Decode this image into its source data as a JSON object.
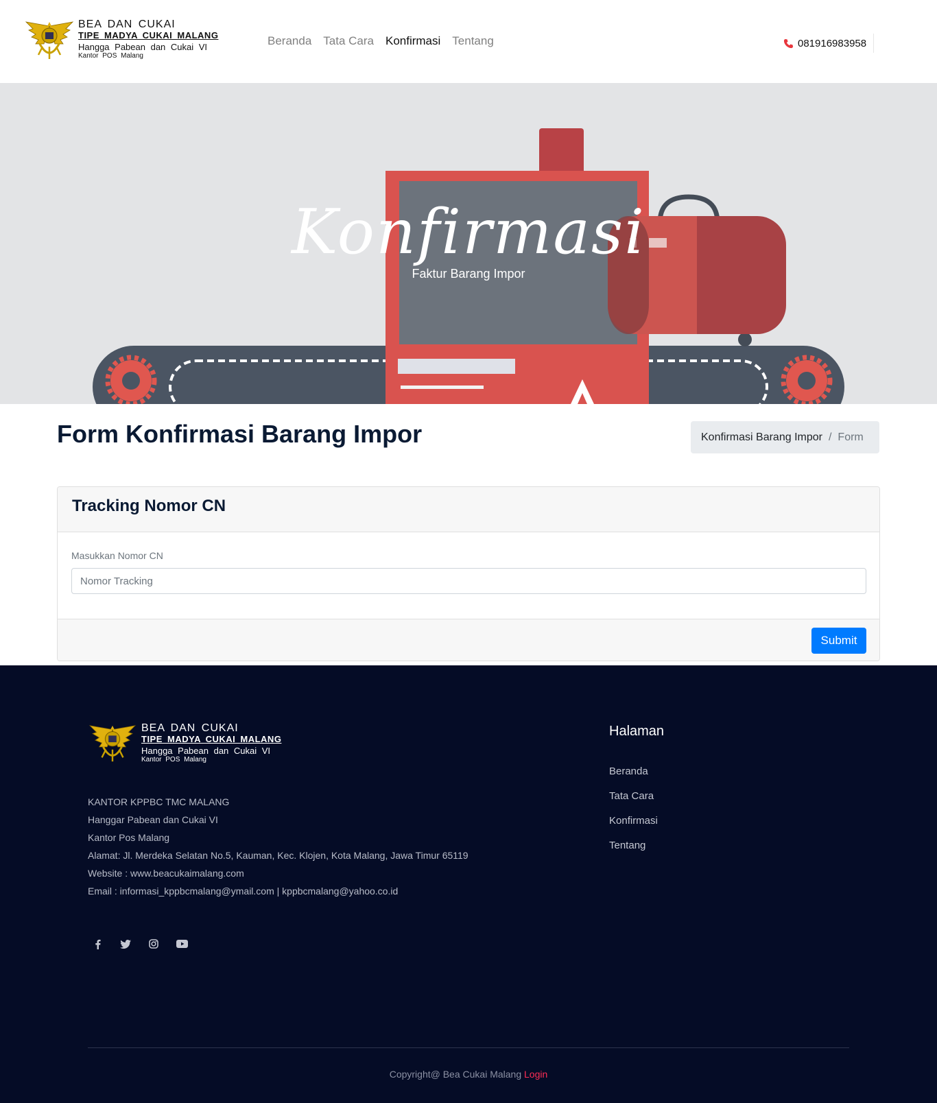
{
  "brand": {
    "line1": "BEA  DAN  CUKAI",
    "line2": "TIPE  MADYA  CUKAI  MALANG",
    "line3": "Hangga  Pabean  dan  Cukai  VI",
    "line4": "Kantor  POS  Malang",
    "emblem_icon": "customs-emblem-icon"
  },
  "nav": {
    "items": [
      {
        "label": "Beranda",
        "active": false
      },
      {
        "label": "Tata Cara",
        "active": false
      },
      {
        "label": "Konfirmasi",
        "active": true
      },
      {
        "label": "Tentang",
        "active": false
      }
    ]
  },
  "contact": {
    "phone": "081916983958",
    "phone_icon": "phone-icon"
  },
  "hero": {
    "title": "Konfirmasi",
    "subtitle": "Faktur Barang Impor"
  },
  "page": {
    "title": "Form Konfirmasi Barang Impor",
    "breadcrumb": [
      "Konfirmasi Barang Impor",
      "/",
      "Form"
    ]
  },
  "form": {
    "heading": "Tracking Nomor CN",
    "label": "Masukkan Nomor CN",
    "placeholder": "Nomor Tracking",
    "submit": "Submit"
  },
  "footer": {
    "address_lines": [
      "KANTOR KPPBC TMC MALANG",
      "Hanggar Pabean dan Cukai VI",
      "Kantor Pos Malang",
      "Alamat: Jl. Merdeka Selatan No.5, Kauman, Kec. Klojen, Kota Malang, Jawa Timur 65119",
      "Website : www.beacukaimalang.com",
      "Email : informasi_kppbcmalang@ymail.com | kppbcmalang@yahoo.co.id"
    ],
    "social": [
      "facebook-icon",
      "twitter-icon",
      "instagram-icon",
      "youtube-icon"
    ],
    "pages_title": "Halaman",
    "pages": [
      "Beranda",
      "Tata Cara",
      "Konfirmasi",
      "Tentang"
    ],
    "copyright": "Copyright@ Bea Cukai Malang",
    "login": "Login"
  },
  "colors": {
    "accent": "#007bff",
    "footer_bg": "#050c26",
    "login": "#ff2d55",
    "hero_bg": "#e3e4e6"
  }
}
